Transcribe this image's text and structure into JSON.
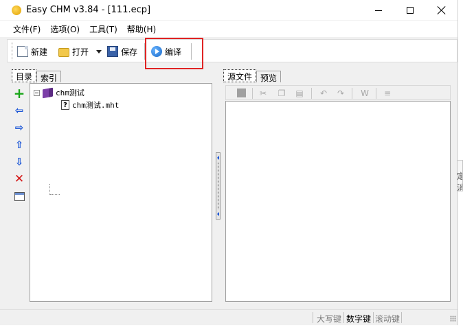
{
  "window": {
    "title": "Easy CHM v3.84 - [111.ecp]",
    "controls": {
      "minimize": "minimize",
      "maximize": "maximize",
      "close": "close"
    }
  },
  "menubar": {
    "items": [
      {
        "label": "文件(F)"
      },
      {
        "label": "选项(O)"
      },
      {
        "label": "工具(T)"
      },
      {
        "label": "帮助(H)"
      }
    ]
  },
  "toolbar": {
    "new_label": "新建",
    "open_label": "打开",
    "save_label": "保存",
    "compile_label": "编译",
    "highlight_color": "#e02424"
  },
  "left_panel": {
    "tabs": [
      {
        "label": "目录",
        "active": true
      },
      {
        "label": "索引",
        "active": false
      }
    ],
    "side_icons": [
      "add-icon",
      "left-arrow-icon",
      "right-arrow-icon",
      "up-arrow-icon",
      "down-arrow-icon",
      "delete-icon",
      "properties-icon"
    ],
    "tree": {
      "root": {
        "label": "chm测试",
        "icon": "book-icon",
        "expanded": true
      },
      "children": [
        {
          "label": "chm测试.mht",
          "icon": "help-page-icon",
          "glyph": "?"
        }
      ]
    }
  },
  "right_panel": {
    "tabs": [
      {
        "label": "源文件",
        "active": true
      },
      {
        "label": "预览",
        "active": false
      }
    ],
    "editor_toolbar_icons": [
      "stop-icon",
      "cut-icon",
      "copy-icon",
      "paste-icon",
      "undo-icon",
      "redo-icon",
      "wrap-icon",
      "format-icon"
    ],
    "editor_content": ""
  },
  "statusbar": {
    "caps": "大写键",
    "num": "数字键",
    "scroll": "滚动键"
  },
  "background": {
    "peek_text": "定消"
  }
}
